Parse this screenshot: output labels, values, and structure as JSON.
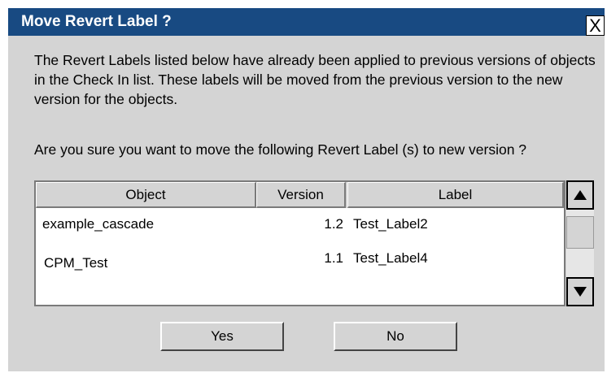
{
  "dialog": {
    "title": "Move Revert Label ?",
    "close_glyph": "X",
    "message": "The Revert Labels listed below have already been applied to previous versions of objects in the Check In list. These labels will be moved from the previous version to the new version for the objects.",
    "question": "Are you sure you want to move the following Revert Label (s) to new version ?"
  },
  "table": {
    "columns": [
      "Object",
      "Version",
      "Label"
    ],
    "rows": [
      {
        "object": "example_cascade",
        "version": "1.2",
        "label": "Test_Label2"
      },
      {
        "object": "CPM_Test",
        "version": "1.1",
        "label": "Test_Label4"
      }
    ]
  },
  "scrollbar": {
    "up_icon": "arrow-up-icon",
    "down_icon": "arrow-down-icon"
  },
  "buttons": {
    "yes": "Yes",
    "no": "No"
  },
  "colors": {
    "titlebar": "#184a82",
    "dialog_bg": "#d4d4d4"
  }
}
